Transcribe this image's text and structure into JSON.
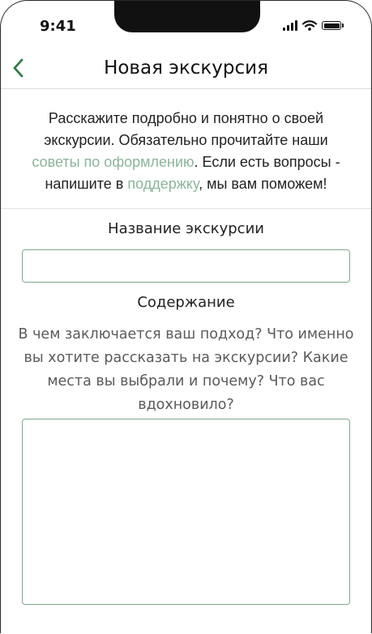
{
  "status_bar": {
    "time": "9:41"
  },
  "nav": {
    "title": "Новая экскурсия"
  },
  "intro": {
    "part1": "Расскажите подробно и понятно о своей экскурсии. Обязательно прочитайте наши ",
    "link1": "советы по оформлению",
    "part2": ". Если есть вопросы - напишите в ",
    "link2": "поддержку",
    "part3": ", мы вам поможем!"
  },
  "form": {
    "title_label": "Название экскурсии",
    "title_value": "",
    "content_label": "Содержание",
    "content_hint": "В чем заключается ваш подход? Что именно вы хотите рассказать на экскурсии? Какие места вы выбрали и почему? Что вас вдохновило?",
    "content_value": ""
  },
  "colors": {
    "accent": "#2e7d46",
    "link": "#8bb59a",
    "field_border": "#7ea98d"
  }
}
